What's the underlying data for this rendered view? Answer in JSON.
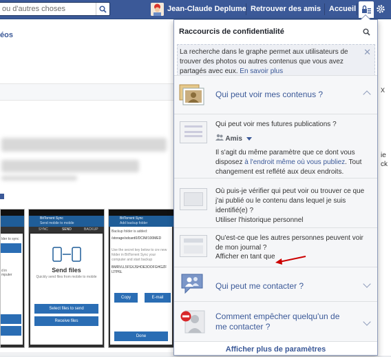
{
  "topbar": {
    "search_placeholder": "ou d'autres choses",
    "user_name": "Jean-Claude Deplume",
    "find_friends": "Retrouver des amis",
    "home": "Accueil"
  },
  "background": {
    "partial_link": "éos",
    "phone_screens": [
      {
        "app": "",
        "lines": [
          "",
          "lder to sync",
          "",
          "d in",
          "mputer"
        ]
      },
      {
        "app": "BitTorrent Sync",
        "subtitle": "Send mobile to mobile",
        "tabs": [
          "SYNC",
          "SEND",
          "BACKUP"
        ],
        "heading": "Send files",
        "desc": "Quickly send files from mobile to mobile",
        "btn1": "Select files to send",
        "btn2": "Receive files"
      },
      {
        "app": "BitTorrent Sync",
        "subtitle": "Add backup folder",
        "text1": "Backup folder is added:",
        "text2": "/storage/sdcard0/DCIM/100MED",
        "text3": "Use the secret key below to cre new folder in BitTorrent Sync your computer and start backup",
        "key": "BMRVLL5FSXJSHOE3OOFGHGZF IJ7P6L",
        "btn1": "Copy",
        "btn2": "E-mail",
        "btn3": "Done"
      }
    ],
    "right_fragments": [
      "x",
      "ie",
      "ck"
    ]
  },
  "panel": {
    "title": "Raccourcis de confidentialité",
    "info_text": "La recherche dans le graphe permet aux utilisateurs de trouver des photos ou autres contenus que vous avez partagés avec eux.",
    "info_link": "En savoir plus",
    "section1": {
      "label": "Qui peut voir mes contenus ?",
      "q1": "Qui peut voir mes futures publications ?",
      "audience": "Amis",
      "q1_desc_a": "Il s'agit du même paramètre que ce dont vous disposez ",
      "q1_desc_link": "à l'endroit même où vous publiez",
      "q1_desc_b": ". Tout changement est reflété aux deux endroits.",
      "q2": "Où puis-je vérifier qui peut voir ou trouver ce que j'ai publié ou le contenu dans lequel je suis identifié(e) ?",
      "q2_link": "Utiliser l'historique personnel",
      "q3": "Qu'est-ce que les autres personnes peuvent voir de mon journal ?",
      "q3_link": "Afficher en tant que"
    },
    "section2": {
      "label": "Qui peut me contacter ?"
    },
    "section3": {
      "label": "Comment empêcher quelqu'un de me contacter ?"
    },
    "footer": "Afficher plus de paramètres"
  },
  "colors": {
    "brand": "#3b5998",
    "annotation_arrow": "#cc0000"
  }
}
